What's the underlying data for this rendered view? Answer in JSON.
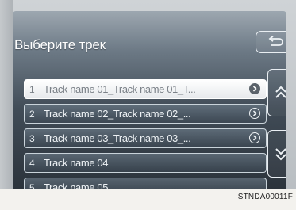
{
  "screen": {
    "title": "Выберите трек",
    "back_icon": "back-arrow-icon",
    "tracks": [
      {
        "num": "1",
        "name": "Track name 01_Track name 01_T...",
        "selected": true,
        "has_info": true
      },
      {
        "num": "2",
        "name": "Track name 02_Track name 02_...",
        "selected": false,
        "has_info": true
      },
      {
        "num": "3",
        "name": "Track name 03_Track name 03_...",
        "selected": false,
        "has_info": true
      },
      {
        "num": "4",
        "name": "Track name 04",
        "selected": false,
        "has_info": false
      },
      {
        "num": "5",
        "name": "Track name 05",
        "selected": false,
        "has_info": false
      }
    ],
    "scroll_up_icon": "double-chevron-up-icon",
    "scroll_down_icon": "double-chevron-down-icon"
  },
  "figure_code": "STNDA00011F",
  "colors": {
    "screen_top": "#9da7b0",
    "screen_bottom": "#2b333b",
    "selected_row": "#ffffff",
    "text": "#eef2f5"
  }
}
